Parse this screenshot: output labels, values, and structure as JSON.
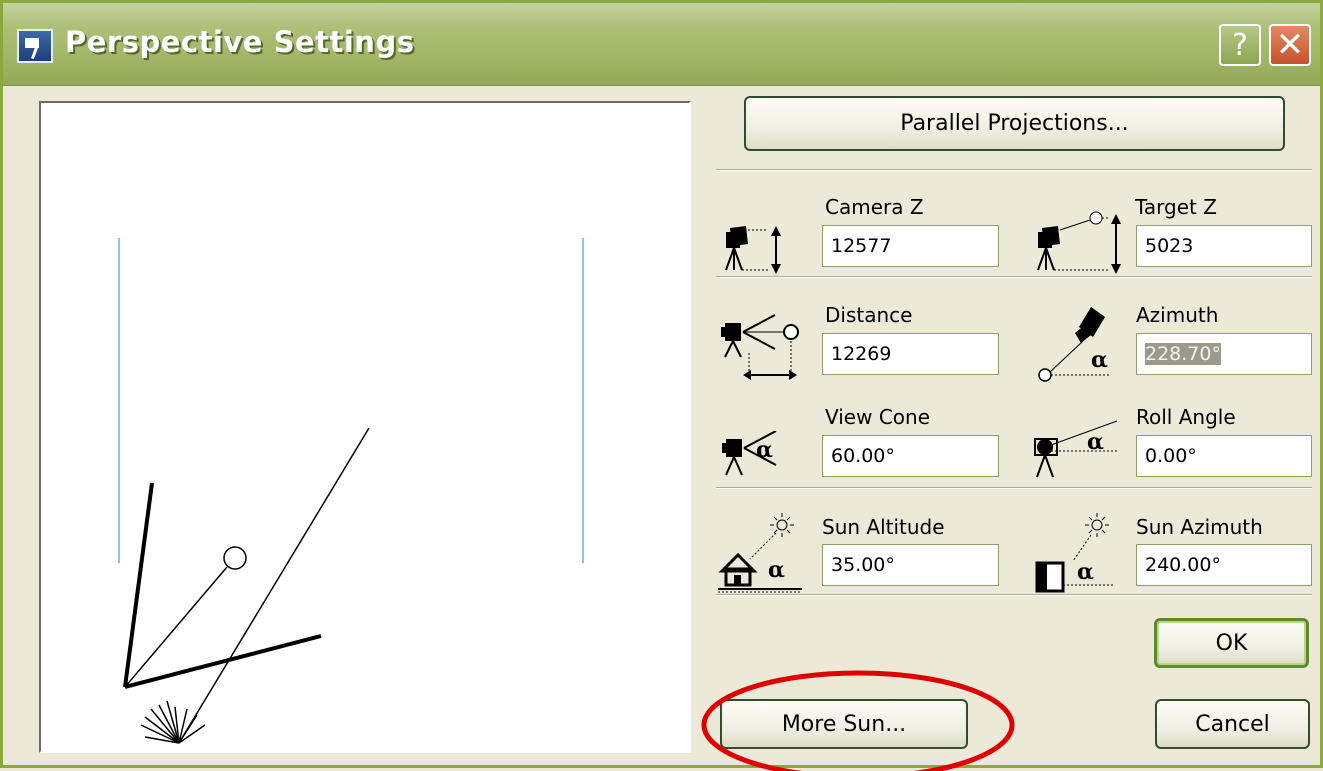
{
  "window": {
    "title": "Perspective Settings",
    "help_label": "?",
    "close_label": "✕"
  },
  "buttons": {
    "parallel_projections": "Parallel Projections...",
    "ok": "OK",
    "cancel": "Cancel",
    "more_sun": "More Sun..."
  },
  "fields": {
    "camera_z": {
      "label": "Camera Z",
      "value": "12577"
    },
    "target_z": {
      "label": "Target Z",
      "value": "5023"
    },
    "distance": {
      "label": "Distance",
      "value": "12269"
    },
    "azimuth": {
      "label": "Azimuth",
      "value": "228.70°"
    },
    "view_cone": {
      "label": "View Cone",
      "value": "60.00°"
    },
    "roll_angle": {
      "label": "Roll Angle",
      "value": "0.00°"
    },
    "sun_altitude": {
      "label": "Sun Altitude",
      "value": "35.00°"
    },
    "sun_azimuth": {
      "label": "Sun Azimuth",
      "value": "240.00°"
    }
  },
  "annotation": {
    "highlight_color": "#e00000"
  },
  "icons": {
    "camera_z": "camera-height-icon",
    "target_z": "target-height-icon",
    "distance": "camera-distance-icon",
    "azimuth": "camera-azimuth-icon",
    "view_cone": "view-cone-icon",
    "roll_angle": "roll-angle-icon",
    "sun_altitude": "sun-altitude-icon",
    "sun_azimuth": "sun-azimuth-icon"
  }
}
